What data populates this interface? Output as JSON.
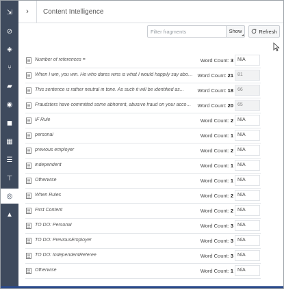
{
  "nav": {
    "items": [
      {
        "icon": "import-icon",
        "glyph": "⇲"
      },
      {
        "icon": "attachment-icon",
        "glyph": "⊘"
      },
      {
        "icon": "layers-icon",
        "glyph": "◈"
      },
      {
        "icon": "merge-icon",
        "glyph": "⑂"
      },
      {
        "icon": "tag-icon",
        "glyph": "▰"
      },
      {
        "icon": "palette-icon",
        "glyph": "◉"
      },
      {
        "icon": "binoculars-icon",
        "glyph": "◼"
      },
      {
        "icon": "table-icon",
        "glyph": "▦"
      },
      {
        "icon": "list-icon",
        "glyph": "☰"
      },
      {
        "icon": "split-icon",
        "glyph": "⊤"
      },
      {
        "icon": "fingerprint-icon",
        "glyph": "◎",
        "active": true
      },
      {
        "icon": "warning-icon",
        "glyph": "▲"
      }
    ]
  },
  "header": {
    "collapse_glyph": "›",
    "title": "Content Intelligence"
  },
  "toolbar": {
    "search_placeholder": "Filter fragments",
    "show_label": "Show",
    "refresh_label": "Refresh"
  },
  "rows": [
    {
      "text": "Number of references =",
      "wc_label": "Word Count:",
      "count": "3",
      "score": "N/A",
      "filled": false
    },
    {
      "text": "When I win, you win. He who dares wins is what I would happily say about t...",
      "wc_label": "Word Count:",
      "count": "21",
      "score": "81",
      "filled": true
    },
    {
      "text": "This sentence is rather neutral in tone. As such it will be identified as...",
      "wc_label": "Word Count:",
      "count": "18",
      "score": "66",
      "filled": true
    },
    {
      "text": "Fraudsters have committed some abhorent, abusive fraud on your account. ...",
      "wc_label": "Word Count:",
      "count": "20",
      "score": "65",
      "filled": true
    },
    {
      "text": "IF Rule",
      "wc_label": "Word Count:",
      "count": "2",
      "score": "N/A",
      "filled": false
    },
    {
      "text": "personal",
      "wc_label": "Word Count:",
      "count": "1",
      "score": "N/A",
      "filled": false
    },
    {
      "text": "previous employer",
      "wc_label": "Word Count:",
      "count": "2",
      "score": "N/A",
      "filled": false
    },
    {
      "text": "independent",
      "wc_label": "Word Count:",
      "count": "1",
      "score": "N/A",
      "filled": false
    },
    {
      "text": "Otherwise",
      "wc_label": "Word Count:",
      "count": "1",
      "score": "N/A",
      "filled": false
    },
    {
      "text": "When Rules",
      "wc_label": "Word Count:",
      "count": "2",
      "score": "N/A",
      "filled": false
    },
    {
      "text": "First Content",
      "wc_label": "Word Count:",
      "count": "2",
      "score": "N/A",
      "filled": false
    },
    {
      "text": "TO DO: Personal",
      "wc_label": "Word Count:",
      "count": "3",
      "score": "N/A",
      "filled": false
    },
    {
      "text": "TO DO: PreviousEmployer",
      "wc_label": "Word Count:",
      "count": "3",
      "score": "N/A",
      "filled": false
    },
    {
      "text": "TO DO: IndependentReferee",
      "wc_label": "Word Count:",
      "count": "3",
      "score": "N/A",
      "filled": false
    },
    {
      "text": "Otherwise",
      "wc_label": "Word Count:",
      "count": "1",
      "score": "N/A",
      "filled": false
    }
  ]
}
